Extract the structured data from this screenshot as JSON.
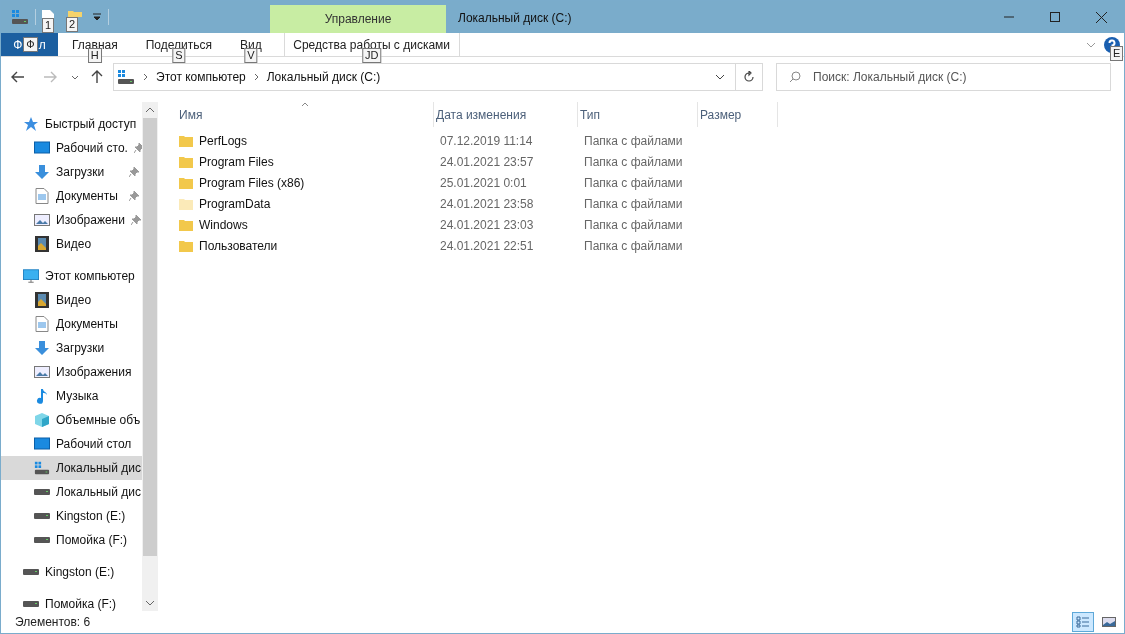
{
  "window": {
    "title": "Локальный диск (C:)",
    "context_tab": "Управление"
  },
  "quick_access_keytips": [
    "1",
    "2"
  ],
  "ribbon": {
    "file_tab": {
      "label_start": "Ф",
      "keytip": "Ф",
      "label_end": "л"
    },
    "tabs": [
      {
        "label": "Главная",
        "keytip": "H",
        "selected": false
      },
      {
        "label": "Поделиться",
        "keytip": "S",
        "selected": false
      },
      {
        "label": "Вид",
        "keytip": "V",
        "selected": false
      },
      {
        "label": "Средства работы с дисками",
        "keytip": "JD",
        "selected": false
      }
    ],
    "help_keytip": "E"
  },
  "address": {
    "crumbs": [
      "Этот компьютер",
      "Локальный диск (C:)"
    ]
  },
  "search": {
    "placeholder": "Поиск: Локальный диск (C:)"
  },
  "sidebar": {
    "items": [
      {
        "label": "Быстрый доступ",
        "kind": "star",
        "selected": false,
        "children": [
          {
            "label": "Рабочий сто.",
            "kind": "desktop",
            "pinned": true,
            "selected": false
          },
          {
            "label": "Загрузки",
            "kind": "download",
            "pinned": true,
            "selected": false
          },
          {
            "label": "Документы",
            "kind": "document",
            "pinned": true,
            "selected": false
          },
          {
            "label": "Изображени",
            "kind": "pictures",
            "pinned": true,
            "selected": false
          },
          {
            "label": "Видео",
            "kind": "video",
            "pinned": false,
            "selected": false
          }
        ]
      },
      {
        "label": "Этот компьютер",
        "kind": "computer",
        "selected": false,
        "children": [
          {
            "label": "Видео",
            "kind": "video",
            "pinned": false,
            "selected": false
          },
          {
            "label": "Документы",
            "kind": "document",
            "pinned": false,
            "selected": false
          },
          {
            "label": "Загрузки",
            "kind": "download",
            "pinned": false,
            "selected": false
          },
          {
            "label": "Изображения",
            "kind": "pictures",
            "pinned": false,
            "selected": false
          },
          {
            "label": "Музыка",
            "kind": "music",
            "pinned": false,
            "selected": false
          },
          {
            "label": "Объемные объ",
            "kind": "cube",
            "pinned": false,
            "selected": false
          },
          {
            "label": "Рабочий стол",
            "kind": "desktop",
            "pinned": false,
            "selected": false
          },
          {
            "label": "Локальный дис",
            "kind": "windrive",
            "pinned": false,
            "selected": true
          },
          {
            "label": "Локальный дис",
            "kind": "drive",
            "pinned": false,
            "selected": false
          },
          {
            "label": "Kingston (E:)",
            "kind": "drive",
            "pinned": false,
            "selected": false
          },
          {
            "label": "Помойка (F:)",
            "kind": "drive",
            "pinned": false,
            "selected": false
          }
        ]
      },
      {
        "label": "Kingston (E:)",
        "kind": "drive",
        "selected": false
      },
      {
        "label": "Помойка (F:)",
        "kind": "drive",
        "selected": false
      }
    ]
  },
  "table": {
    "columns": [
      {
        "label": "Имя",
        "sorted": true
      },
      {
        "label": "Дата изменения",
        "sorted": false
      },
      {
        "label": "Тип",
        "sorted": false
      },
      {
        "label": "Размер",
        "sorted": false
      }
    ],
    "rows": [
      {
        "name": "PerfLogs",
        "date": "07.12.2019 11:14",
        "type": "Папка с файлами",
        "hidden": false
      },
      {
        "name": "Program Files",
        "date": "24.01.2021 23:57",
        "type": "Папка с файлами",
        "hidden": false
      },
      {
        "name": "Program Files (x86)",
        "date": "25.01.2021 0:01",
        "type": "Папка с файлами",
        "hidden": false
      },
      {
        "name": "ProgramData",
        "date": "24.01.2021 23:58",
        "type": "Папка с файлами",
        "hidden": true
      },
      {
        "name": "Windows",
        "date": "24.01.2021 23:03",
        "type": "Папка с файлами",
        "hidden": false
      },
      {
        "name": "Пользователи",
        "date": "24.01.2021 22:51",
        "type": "Папка с файлами",
        "hidden": false
      }
    ]
  },
  "status_bar": {
    "count": "Элементов: 6",
    "views": [
      {
        "kind": "details",
        "selected": true
      },
      {
        "kind": "thumbnails",
        "selected": false
      }
    ]
  }
}
